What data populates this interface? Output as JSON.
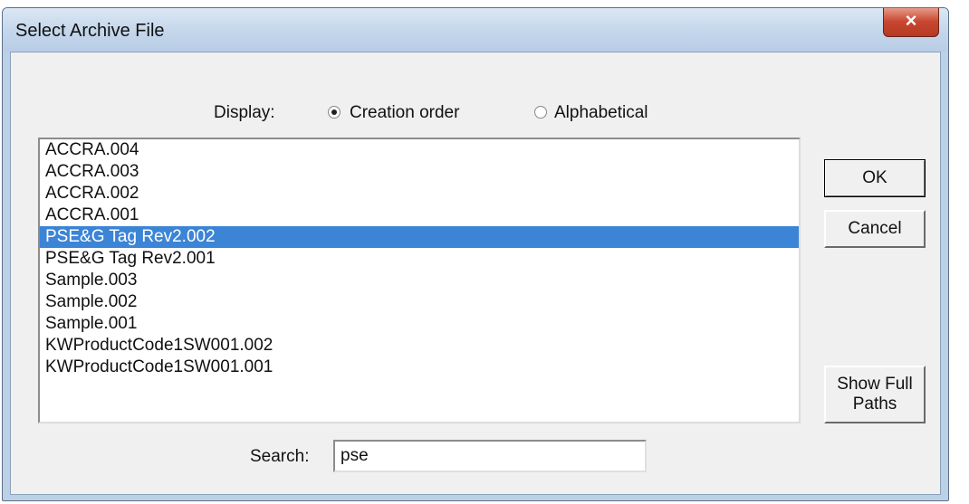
{
  "window": {
    "title": "Select Archive File",
    "close_glyph": "×"
  },
  "display": {
    "label": "Display:",
    "options": [
      {
        "label": "Creation order",
        "checked": true
      },
      {
        "label": "Alphabetical",
        "checked": false
      }
    ]
  },
  "list": {
    "selected_index": 4,
    "items": [
      "ACCRA.004",
      "ACCRA.003",
      "ACCRA.002",
      "ACCRA.001",
      "PSE&G Tag Rev2.002",
      "PSE&G Tag Rev2.001",
      "Sample.003",
      "Sample.002",
      "Sample.001",
      "KWProductCode1SW001.002",
      "KWProductCode1SW001.001"
    ]
  },
  "buttons": {
    "ok": "OK",
    "cancel": "Cancel",
    "show_full_paths_line1": "Show Full",
    "show_full_paths_line2": "Paths"
  },
  "search": {
    "label": "Search:",
    "value": "pse"
  },
  "colors": {
    "selection": "#3b84d6",
    "close": "#c8462f"
  }
}
